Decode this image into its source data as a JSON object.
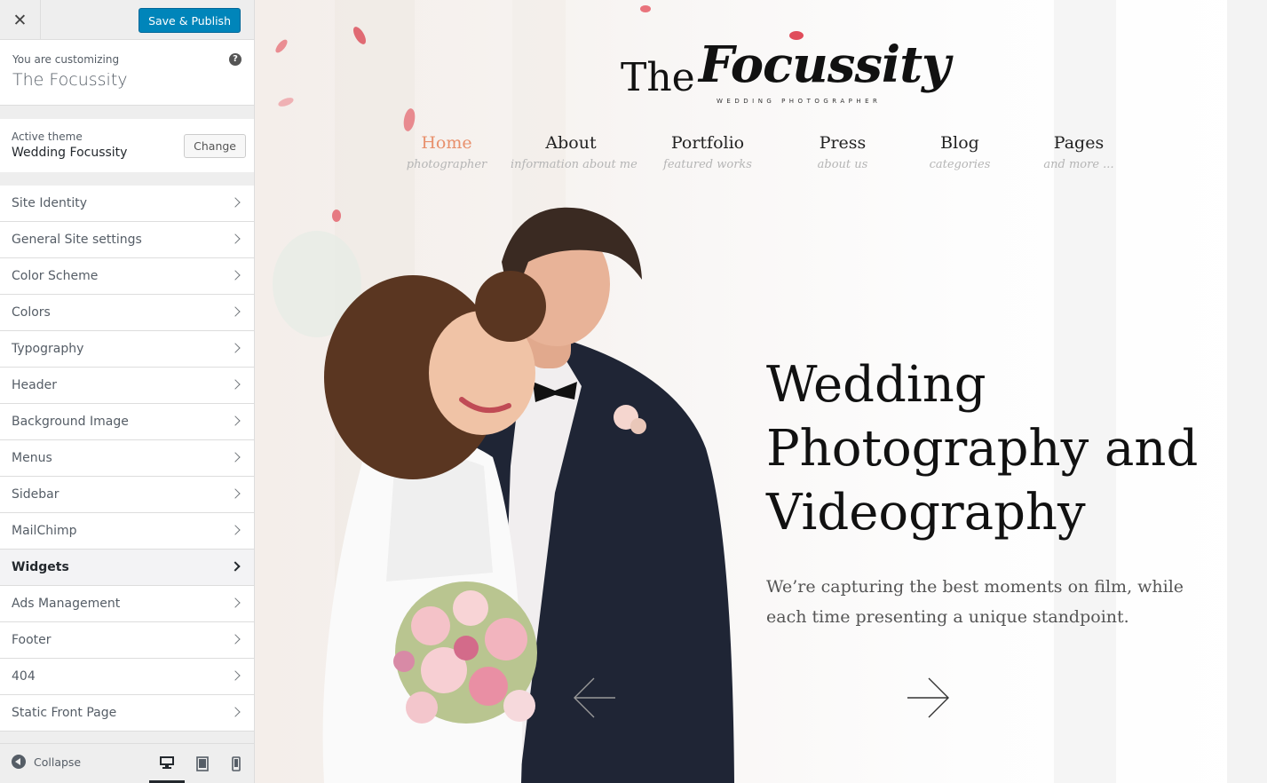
{
  "sidebar": {
    "close_icon": "close-icon",
    "save_label": "Save & Publish",
    "customizing_label": "You are customizing",
    "site_name": "The Focussity",
    "help_icon": "question-icon",
    "active_theme_label": "Active theme",
    "active_theme_name": "Wedding Focussity",
    "change_label": "Change",
    "sections": [
      {
        "label": "Site Identity"
      },
      {
        "label": "General Site settings"
      },
      {
        "label": "Color Scheme"
      },
      {
        "label": "Colors"
      },
      {
        "label": "Typography"
      },
      {
        "label": "Header"
      },
      {
        "label": "Background Image"
      },
      {
        "label": "Menus"
      },
      {
        "label": "Sidebar"
      },
      {
        "label": "MailChimp"
      },
      {
        "label": "Widgets"
      },
      {
        "label": "Ads Management"
      },
      {
        "label": "Footer"
      },
      {
        "label": "404"
      },
      {
        "label": "Static Front Page"
      }
    ],
    "active_section": "Widgets",
    "collapse_label": "Collapse",
    "devices": [
      "desktop-icon",
      "tablet-icon",
      "mobile-icon"
    ]
  },
  "preview": {
    "logo": {
      "prefix": "The",
      "script": "Focussity",
      "tagline": "WEDDING PHOTOGRAPHER"
    },
    "nav": [
      {
        "label": "Home",
        "sub": "photographer"
      },
      {
        "label": "About",
        "sub": "information about me"
      },
      {
        "label": "Portfolio",
        "sub": "featured works"
      },
      {
        "label": "Press",
        "sub": "about us"
      },
      {
        "label": "Blog",
        "sub": "categories"
      },
      {
        "label": "Pages",
        "sub": "and more ..."
      }
    ],
    "headline": "Wedding Photography and Videography",
    "description": "We’re capturing the best moments on film, while each time presenting a unique standpoint.",
    "colors": {
      "accent": "#e8906c",
      "primary_button": "#0085ba"
    }
  }
}
